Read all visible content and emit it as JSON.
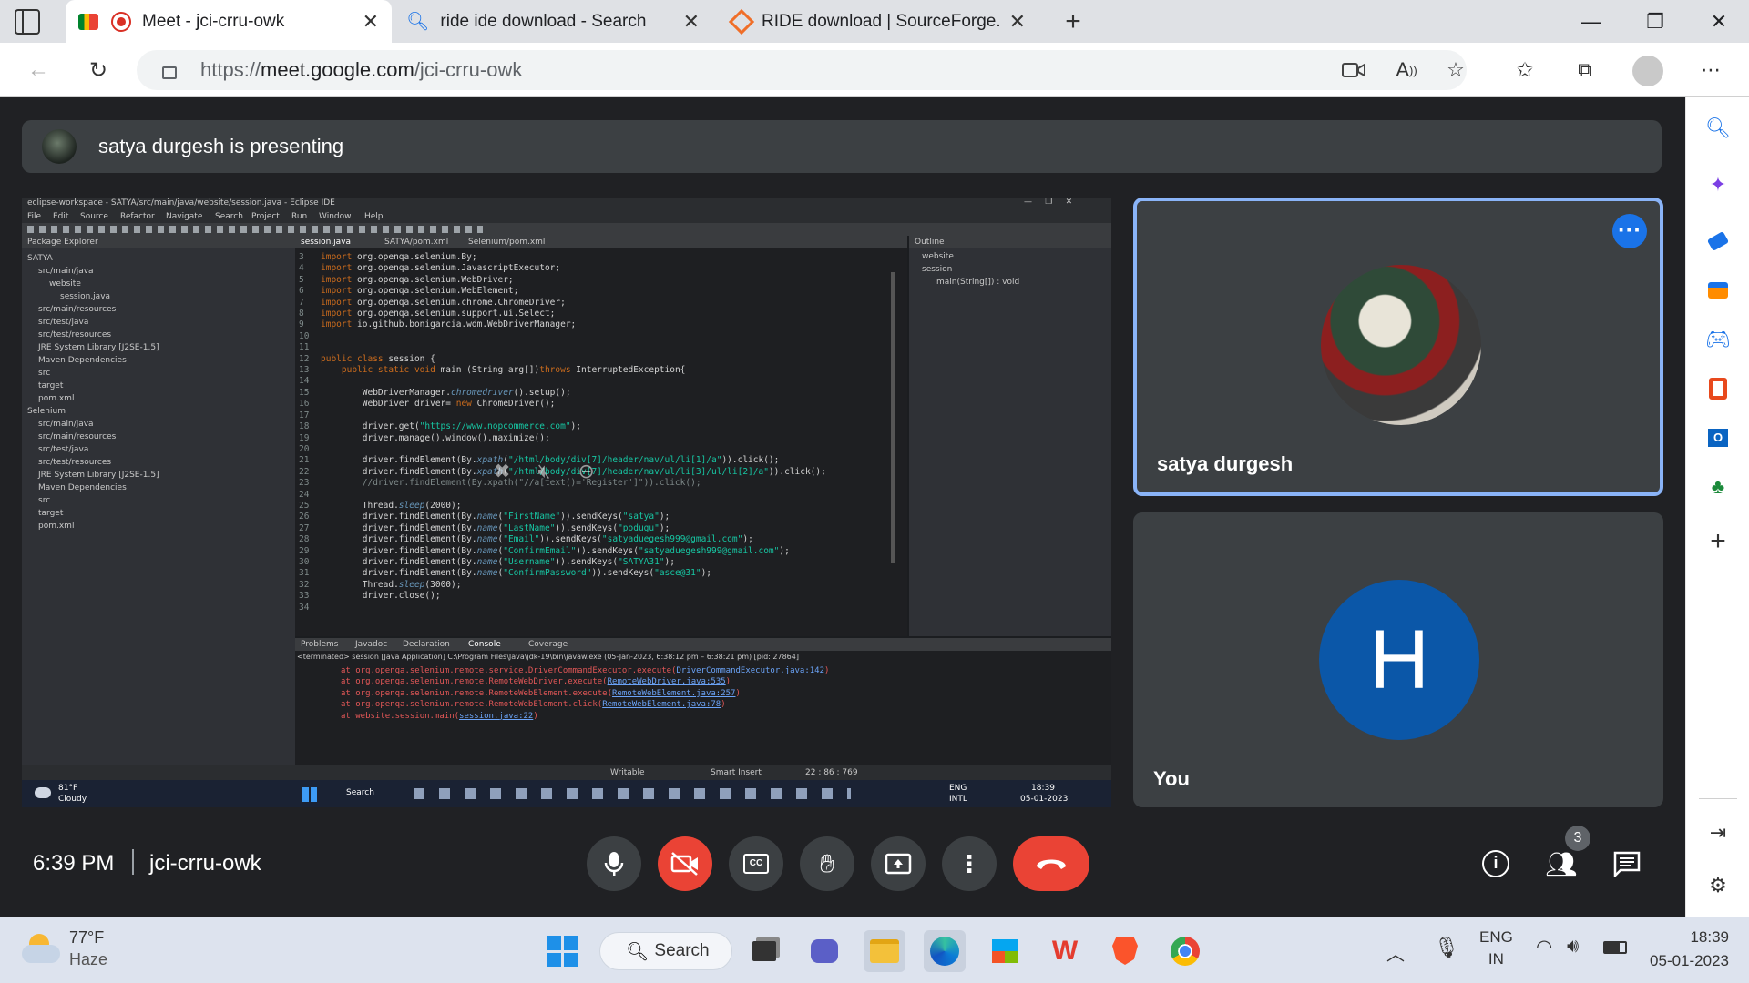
{
  "browser": {
    "tabs": [
      {
        "title": "Meet - jci-crru-owk",
        "active": true
      },
      {
        "title": "ride ide download - Search",
        "active": false
      },
      {
        "title": "RIDE download | SourceForge.ne",
        "active": false
      }
    ],
    "url_prefix": "https://",
    "url_host": "meet.google.com",
    "url_path": "/jci-crru-owk"
  },
  "meet": {
    "presenting_text": "satya durgesh is presenting",
    "participants": [
      {
        "name": "satya durgesh",
        "highlighted": true
      },
      {
        "name": "You",
        "avatar_letter": "H",
        "avatar_color": "#0b57a8"
      }
    ],
    "time": "6:39 PM",
    "meeting_code": "jci-crru-owk",
    "people_count": "3",
    "accent": "#8ab4f8",
    "end_call_color": "#ea4335"
  },
  "eclipse": {
    "title": "eclipse-workspace - SATYA/src/main/java/website/session.java - Eclipse IDE",
    "menu": [
      "File",
      "Edit",
      "Source",
      "Refactor",
      "Navigate",
      "Search",
      "Project",
      "Run",
      "Window",
      "Help"
    ],
    "package_explorer_title": "Package Explorer",
    "tree": [
      "SATYA",
      "src/main/java",
      "website",
      "session.java",
      "src/main/resources",
      "src/test/java",
      "src/test/resources",
      "JRE System Library [J2SE-1.5]",
      "Maven Dependencies",
      "src",
      "target",
      "pom.xml",
      "Selenium",
      "src/main/java",
      "src/main/resources",
      "src/test/java",
      "src/test/resources",
      "JRE System Library [J2SE-1.5]",
      "Maven Dependencies",
      "src",
      "target",
      "pom.xml"
    ],
    "editor_tabs": [
      "session.java",
      "SATYA/pom.xml",
      "Selenium/pom.xml"
    ],
    "outline_title": "Outline",
    "outline_items": [
      "website",
      "session",
      "main(String[]) : void"
    ],
    "console_tabs": [
      "Problems",
      "Javadoc",
      "Declaration",
      "Console",
      "Coverage"
    ],
    "console_header": "<terminated> session [Java Application] C:\\Program Files\\Java\\jdk-19\\bin\\javaw.exe (05-Jan-2023, 6:38:12 pm – 6:38:21 pm) [pid: 27864]",
    "console_lines": [
      {
        "text": "at org.openqa.selenium.remote.service.DriverCommandExecutor.execute(",
        "link": "DriverCommandExecutor.java:142",
        "end": ")"
      },
      {
        "text": "at org.openqa.selenium.remote.RemoteWebDriver.execute(",
        "link": "RemoteWebDriver.java:535",
        "end": ")"
      },
      {
        "text": "at org.openqa.selenium.remote.RemoteWebElement.execute(",
        "link": "RemoteWebElement.java:257",
        "end": ")"
      },
      {
        "text": "at org.openqa.selenium.remote.RemoteWebElement.click(",
        "link": "RemoteWebElement.java:78",
        "end": ")"
      },
      {
        "text": "at website.session.main(",
        "link": "session.java:22",
        "end": ")"
      }
    ],
    "status": [
      "Writable",
      "Smart Insert",
      "22 : 86 : 769"
    ],
    "inner_taskbar": {
      "temp": "81°F",
      "weather": "Cloudy",
      "search": "Search",
      "lang1": "ENG",
      "lang2": "INTL",
      "time": "18:39",
      "date": "05-01-2023"
    }
  },
  "taskbar": {
    "temp": "77°F",
    "weather": "Haze",
    "search": "Search",
    "lang1": "ENG",
    "lang2": "IN",
    "time": "18:39",
    "date": "05-01-2023"
  }
}
